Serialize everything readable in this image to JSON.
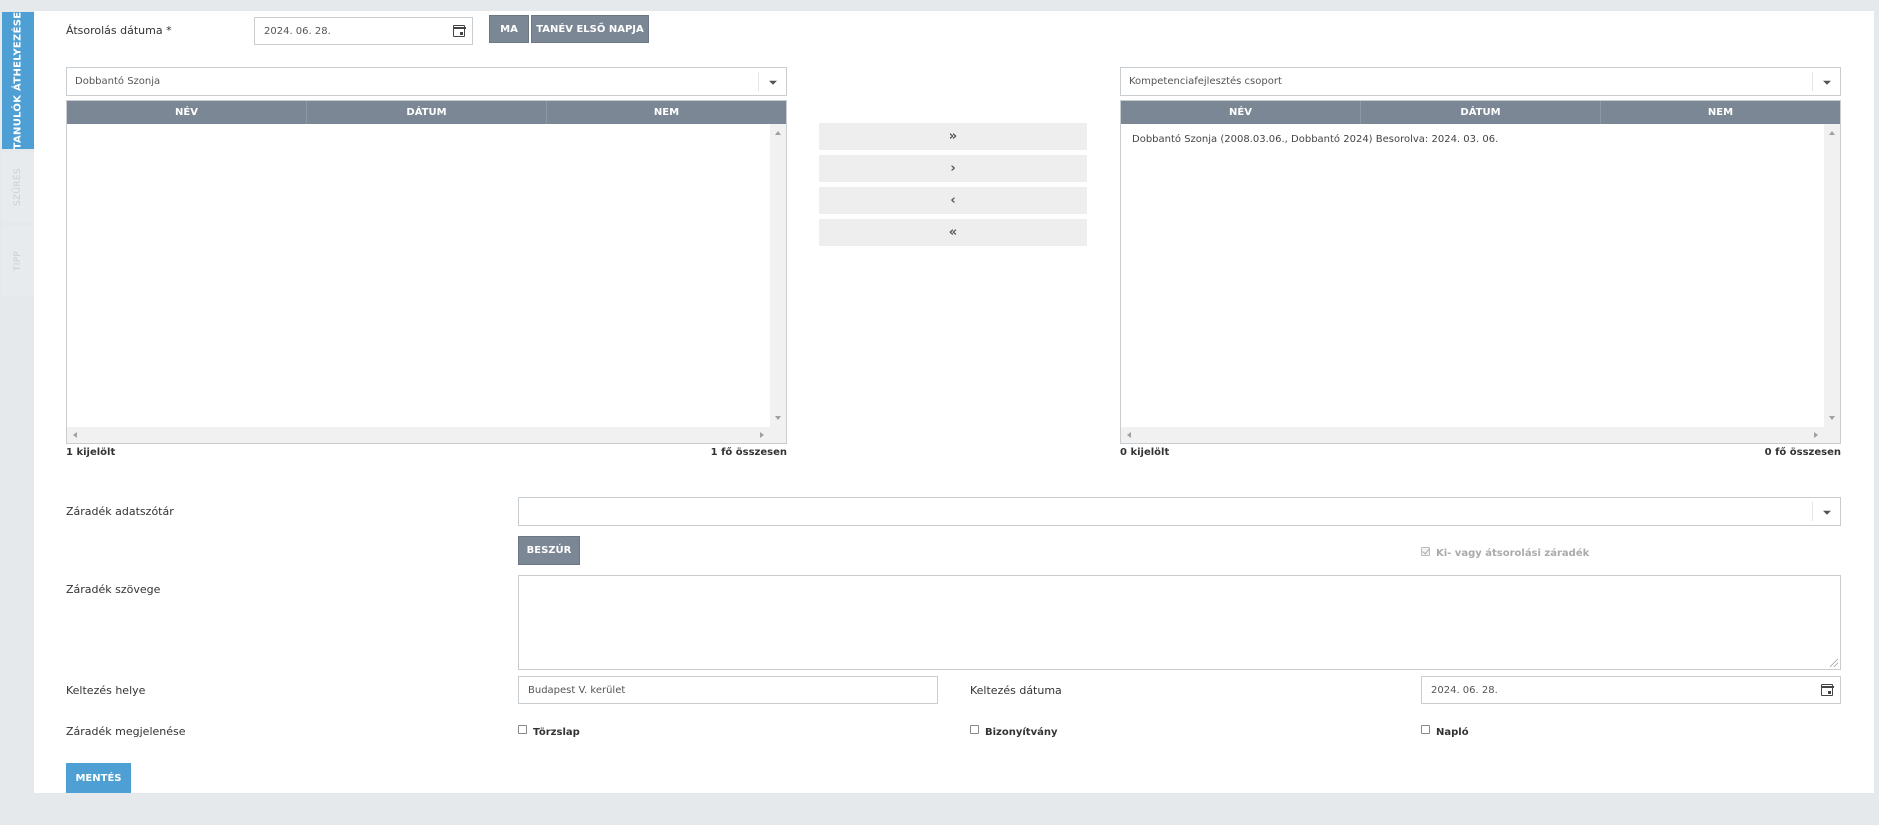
{
  "sidebar": {
    "tabs": [
      {
        "label": "TANULÓK ÁTHELYEZÉSE",
        "active": true
      },
      {
        "label": "SZŰRÉS",
        "active": false
      },
      {
        "label": "TIPP",
        "active": false
      }
    ]
  },
  "top": {
    "date_label": "Átsorolás dátuma *",
    "date_value": "2024. 06. 28.",
    "today_button": "MA",
    "school_year_first_day_button": "TANÉV ELSŐ NAPJA"
  },
  "left_panel": {
    "group_select": "Dobbantó Szonja",
    "columns": [
      "NÉV",
      "DÁTUM",
      "NEM"
    ],
    "rows": [],
    "selected_count": "1 kijelölt",
    "total_count": "1 fő összesen"
  },
  "right_panel": {
    "group_select": "Kompetenciafejlesztés csoport",
    "columns": [
      "NÉV",
      "DÁTUM",
      "NEM"
    ],
    "rows": [
      "Dobbantó Szonja (2008.03.06., Dobbantó 2024) Besorolva: 2024. 03. 06."
    ],
    "selected_count": "0 kijelölt",
    "total_count": "0 fő összesen"
  },
  "move_buttons": {
    "all_right": "»",
    "right": "›",
    "left": "‹",
    "all_left": "«"
  },
  "form": {
    "dictionary_label": "Záradék adatszótár",
    "dictionary_value": "",
    "insert_button": "BESZÚR",
    "exit_clause_checkbox": {
      "label": "Ki- vagy átsorolási záradék",
      "checked": true,
      "disabled": true
    },
    "clause_text_label": "Záradék szövege",
    "clause_text_value": "",
    "place_label": "Keltezés helye",
    "place_value": "Budapest V. kerület",
    "date_label": "Keltezés dátuma",
    "date_value": "2024. 06. 28.",
    "appearance_label": "Záradék megjelenése",
    "appearance_options": [
      {
        "label": "Törzslap",
        "checked": false
      },
      {
        "label": "Bizonyítvány",
        "checked": false
      },
      {
        "label": "Napló",
        "checked": false
      }
    ],
    "save_button": "MENTÉS"
  },
  "colors": {
    "accent_blue": "#4ea0d4",
    "header_gray": "#7b8795",
    "background": "#e6e9ec"
  }
}
